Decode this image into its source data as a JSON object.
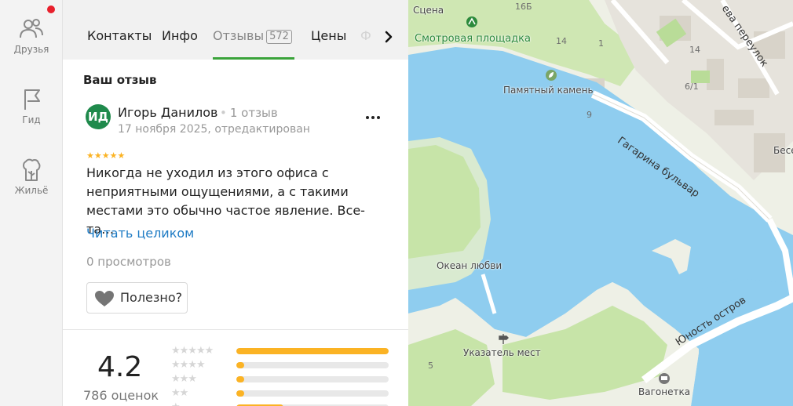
{
  "sidebar": {
    "items": [
      {
        "label": "Друзья",
        "icon": "friends-icon"
      },
      {
        "label": "Гид",
        "icon": "flag-icon"
      },
      {
        "label": "Жильё",
        "icon": "housing-icon"
      }
    ],
    "notification": true
  },
  "tabs": {
    "items": [
      {
        "label": "Контакты"
      },
      {
        "label": "Инфо"
      },
      {
        "label": "Отзывы",
        "count": "572",
        "active": true
      },
      {
        "label": "Цены"
      },
      {
        "label": "Ф"
      }
    ],
    "next_icon": "chevron-right-icon"
  },
  "review": {
    "section_title": "Ваш отзыв",
    "avatar_initials": "ИД",
    "author": "Игорь Данилов",
    "author_reviews": "1 отзыв",
    "date": "17 ноября 2025, отредактирован",
    "stars": "★★★★★",
    "rating": 5,
    "text": "Никогда не уходил из этого офиса с неприятными ощущениями, а с такими местами это обычно частое явление. Все-та…",
    "read_more": "Читать целиком",
    "views": "0 просмотров",
    "useful_label": "Полезно?"
  },
  "rating_summary": {
    "value": "4.2",
    "count_text": "786 оценок",
    "distribution": [
      {
        "stars": "★★★★★",
        "fraction": 1.0
      },
      {
        "stars": "★★★★",
        "fraction": 0.05
      },
      {
        "stars": "★★★",
        "fraction": 0.05
      },
      {
        "stars": "★★",
        "fraction": 0.05
      },
      {
        "stars": "★",
        "fraction": 0.31
      }
    ]
  },
  "map": {
    "labels": {
      "scene": "Сцена",
      "viewpoint": "Смотровая площадка",
      "memory_stone": "Памятный камень",
      "ocean": "Океан любви",
      "pointer": "Указатель мест",
      "wagon": "Вагонетка",
      "besede": "Бесе"
    },
    "roads": {
      "gagarin": "Гагарина бульвар",
      "youth_island": "Юность остров",
      "lane": "ева переулок"
    },
    "house_numbers": [
      "16Б",
      "14",
      "1",
      "14",
      "6/1",
      "9",
      "5"
    ]
  },
  "colors": {
    "accent_green": "#3aa33a",
    "star_yellow": "#fbb324",
    "link_blue": "#1e7bc4",
    "water": "#8fcdef",
    "park": "#c7e4a8"
  }
}
